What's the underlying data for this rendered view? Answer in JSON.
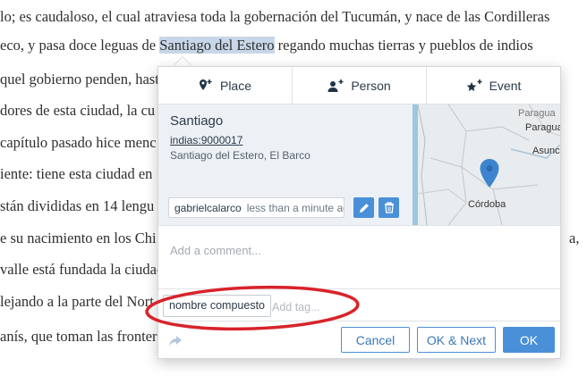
{
  "document": {
    "lines": [
      "lo; es caudaloso, el cual atraviesa toda la gobernación del Tucumán, y nace de las Cordilleras",
      "eco, y pasa doce leguas de ",
      "quel gobierno penden, hast",
      "dores de esta ciudad, la cu",
      "capítulo pasado hice menc",
      "iente: tiene esta ciudad en",
      "stán divididas en 14 lengu",
      "e su nacimiento en los Chi",
      "valle está fundada la ciudad",
      "lejando a la parte del Nort",
      "anís, que toman las frontera"
    ],
    "line2_highlight": "Santiago del Estero",
    "line2_after": " regando muchas tierras y pueblos de indios",
    "right_fragment": "a,"
  },
  "popup": {
    "tabs": [
      {
        "label": "Place",
        "icon": "map-marker-plus-icon"
      },
      {
        "label": "Person",
        "icon": "user-plus-icon"
      },
      {
        "label": "Event",
        "icon": "star-plus-icon"
      }
    ],
    "entity": {
      "title": "Santiago",
      "id_link": "indias:9000017",
      "location": "Santiago del Estero, El Barco"
    },
    "meta": {
      "user": "gabrielcalarco",
      "time": "less than a minute ago"
    },
    "map": {
      "labels": [
        "Paragua",
        "Paragua",
        "Asunc",
        "Córdoba"
      ]
    },
    "comment_placeholder": "Add a comment...",
    "tag": "nombre compuesto",
    "tag_placeholder": "Add tag...",
    "buttons": {
      "cancel": "Cancel",
      "ok_next": "OK & Next",
      "ok": "OK"
    }
  },
  "colors": {
    "accent": "#4a90d9",
    "highlight": "#c8d7e8",
    "annotation_red": "#d8232a"
  }
}
